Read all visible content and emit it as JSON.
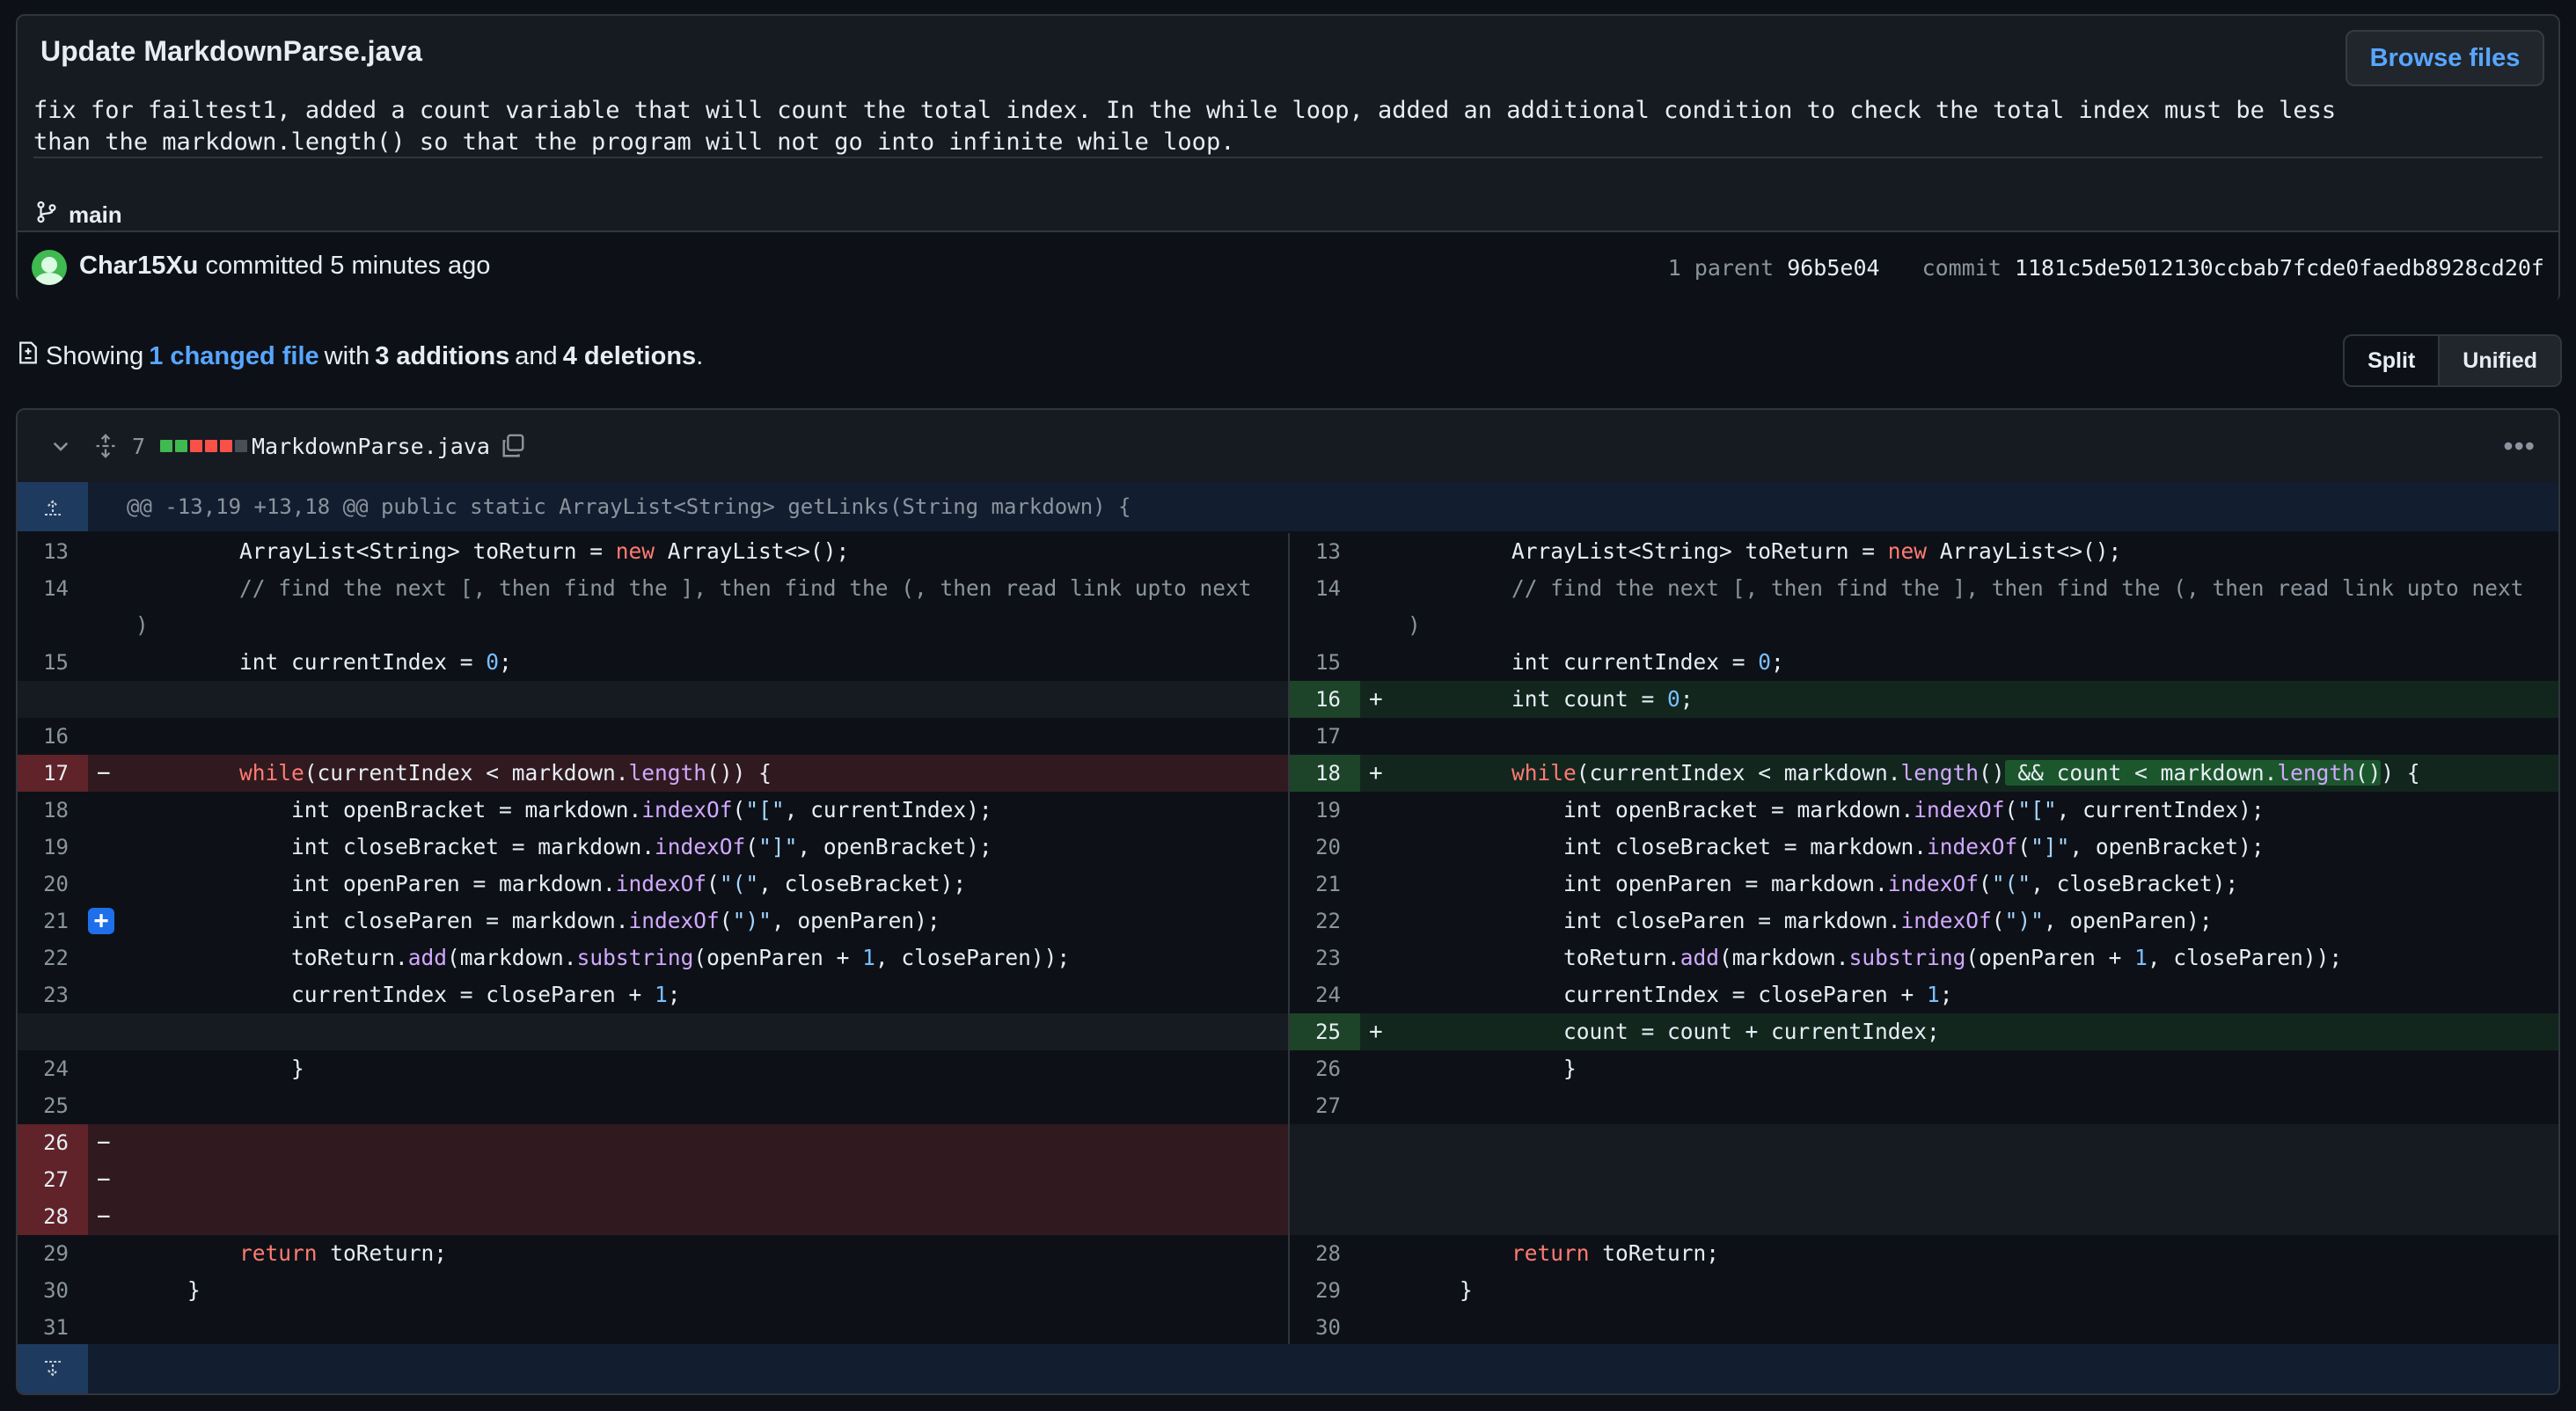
{
  "commit": {
    "title": "Update MarkdownParse.java",
    "description": "fix for failtest1, added a count variable that will count the total index. In the while loop, added an additional condition to check the total index must be less\nthan the markdown.length() so that the program will not go into infinite while loop.",
    "browse_label": "Browse files",
    "branch": "main",
    "author": "Char15Xu",
    "action": " committed 5 minutes ago",
    "parent_label": "1 parent",
    "parent_sha": "96b5e04",
    "commit_label": "commit",
    "commit_sha": "1181c5de5012130ccbab7fcde0faedb8928cd20f"
  },
  "summary": {
    "showing": "Showing",
    "changed_files": "1 changed file",
    "with": "with",
    "additions": "3 additions",
    "and": "and",
    "deletions": "4 deletions",
    "period": "."
  },
  "view": {
    "split": "Split",
    "unified": "Unified",
    "active": "Unified"
  },
  "file": {
    "change_count": "7",
    "name": "MarkdownParse.java",
    "diffstat_colors": [
      "#3fb950",
      "#3fb950",
      "#f85149",
      "#f85149",
      "#f85149",
      "#484f58"
    ],
    "hunk_header": "@@ -13,19 +13,18 @@ public static ArrayList<String> getLinks(String markdown) {"
  },
  "icons": {
    "collapse": "chevron-down-icon",
    "expand": "unfold-icon",
    "copy": "copy-icon",
    "more": "kebab-horizontal-icon",
    "branch": "git-branch-icon",
    "file_diff": "file-diff-icon",
    "expand_up": "fold-up-icon",
    "expand_down": "fold-down-icon"
  },
  "colors": {
    "addition_bg": "#12261e",
    "deletion_bg": "#301a1f",
    "link": "#58a6ff"
  },
  "lines": [
    {
      "l": "13",
      "r": "13",
      "lt": "normal",
      "rt": "normal",
      "lc": "        ArrayList<String> toReturn = new ArrayList<>();",
      "rc": "        ArrayList<String> toReturn = new ArrayList<>();"
    },
    {
      "l": "14",
      "r": "14",
      "lt": "normal",
      "rt": "normal",
      "tall": true,
      "lc": "        // find the next [, then find the ], then find the (, then read link upto next\n)",
      "rc": "        // find the next [, then find the ], then find the (, then read link upto next\n)"
    },
    {
      "l": "15",
      "r": "15",
      "lt": "normal",
      "rt": "normal",
      "lc": "        int currentIndex = 0;",
      "rc": "        int currentIndex = 0;"
    },
    {
      "l": "",
      "r": "16",
      "lt": "empty",
      "rt": "add",
      "lc": "",
      "rc": "        int count = 0;"
    },
    {
      "l": "16",
      "r": "17",
      "lt": "normal",
      "rt": "normal",
      "lc": "",
      "rc": ""
    },
    {
      "l": "17",
      "r": "18",
      "lt": "del",
      "rt": "add",
      "lc": "        while(currentIndex < markdown.length()) {",
      "rc": "        while(currentIndex < markdown.length() && count < markdown.length()) {"
    },
    {
      "l": "18",
      "r": "19",
      "lt": "normal",
      "rt": "normal",
      "lc": "            int openBracket = markdown.indexOf(\"[\", currentIndex);",
      "rc": "            int openBracket = markdown.indexOf(\"[\", currentIndex);"
    },
    {
      "l": "19",
      "r": "20",
      "lt": "normal",
      "rt": "normal",
      "lc": "            int closeBracket = markdown.indexOf(\"]\", openBracket);",
      "rc": "            int closeBracket = markdown.indexOf(\"]\", openBracket);"
    },
    {
      "l": "20",
      "r": "21",
      "lt": "normal",
      "rt": "normal",
      "lc": "            int openParen = markdown.indexOf(\"(\", closeBracket);",
      "rc": "            int openParen = markdown.indexOf(\"(\", closeBracket);"
    },
    {
      "l": "21",
      "r": "22",
      "lt": "normal",
      "rt": "normal",
      "badge": true,
      "lc": "            int closeParen = markdown.indexOf(\")\", openParen);",
      "rc": "            int closeParen = markdown.indexOf(\")\", openParen);"
    },
    {
      "l": "22",
      "r": "23",
      "lt": "normal",
      "rt": "normal",
      "lc": "            toReturn.add(markdown.substring(openParen + 1, closeParen));",
      "rc": "            toReturn.add(markdown.substring(openParen + 1, closeParen));"
    },
    {
      "l": "23",
      "r": "24",
      "lt": "normal",
      "rt": "normal",
      "lc": "            currentIndex = closeParen + 1;",
      "rc": "            currentIndex = closeParen + 1;"
    },
    {
      "l": "",
      "r": "25",
      "lt": "empty",
      "rt": "add",
      "lc": "",
      "rc": "            count = count + currentIndex;"
    },
    {
      "l": "24",
      "r": "26",
      "lt": "normal",
      "rt": "normal",
      "lc": "            }",
      "rc": "            }"
    },
    {
      "l": "25",
      "r": "27",
      "lt": "normal",
      "rt": "normal",
      "lc": "",
      "rc": ""
    },
    {
      "l": "26",
      "r": "",
      "lt": "del",
      "rt": "empty",
      "lc": "",
      "rc": ""
    },
    {
      "l": "27",
      "r": "",
      "lt": "del",
      "rt": "empty",
      "lc": "",
      "rc": ""
    },
    {
      "l": "28",
      "r": "",
      "lt": "del",
      "rt": "empty",
      "lc": "",
      "rc": ""
    },
    {
      "l": "29",
      "r": "28",
      "lt": "normal",
      "rt": "normal",
      "lc": "        return toReturn;",
      "rc": "        return toReturn;"
    },
    {
      "l": "30",
      "r": "29",
      "lt": "normal",
      "rt": "normal",
      "lc": "    }",
      "rc": "    }"
    },
    {
      "l": "31",
      "r": "30",
      "lt": "normal",
      "rt": "normal",
      "lc": "",
      "rc": ""
    }
  ]
}
